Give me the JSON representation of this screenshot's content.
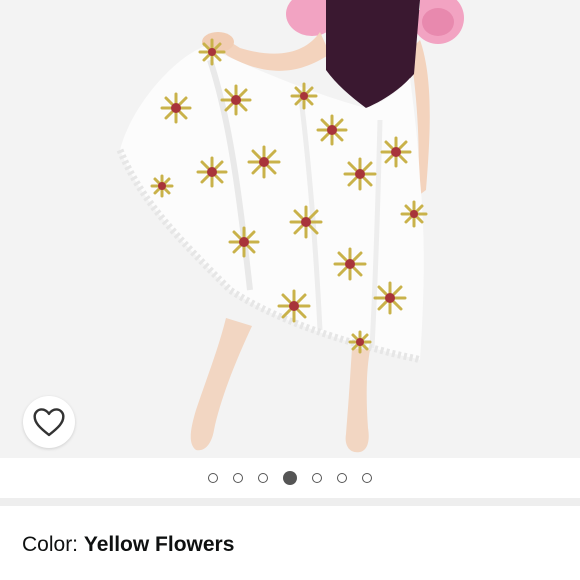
{
  "product": {
    "color_label": "Color: ",
    "color_value": "Yellow Flowers",
    "image_count": 7,
    "active_image_index": 3
  },
  "icons": {
    "wishlist": "heart-outline-icon"
  },
  "colors": {
    "indicator": "#555555",
    "background": "#f3f3f3"
  }
}
